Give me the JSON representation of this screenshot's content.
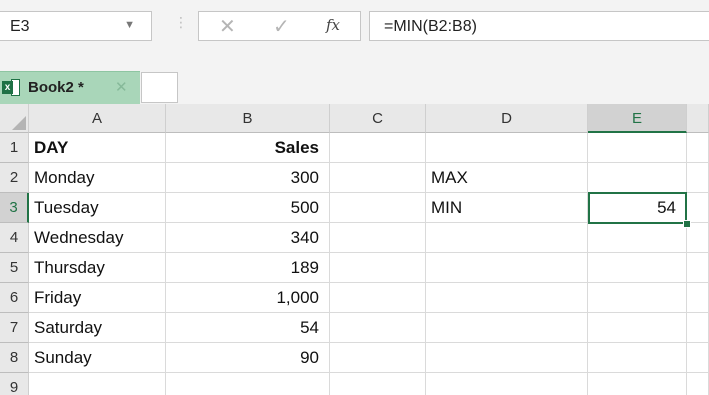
{
  "formula_bar": {
    "name_box": "E3",
    "name_box_dropdown_icon": "chevron-down-icon",
    "grip_glyph": "⋮",
    "cancel_glyph": "✕",
    "enter_glyph": "✓",
    "fx_label": "fx",
    "formula": "=MIN(B2:B8)"
  },
  "workbook_tab": {
    "label": "Book2 *",
    "close_glyph": "✕",
    "icon": "excel-icon"
  },
  "grid": {
    "columns": [
      "A",
      "B",
      "C",
      "D",
      "E"
    ],
    "rows": [
      "1",
      "2",
      "3",
      "4",
      "5",
      "6",
      "7",
      "8",
      "9"
    ],
    "selected_column": "E",
    "selected_row": "3",
    "cells": {
      "A1": "DAY",
      "B1": "Sales",
      "A2": "Monday",
      "B2": "300",
      "D2": "MAX",
      "A3": "Tuesday",
      "B3": "500",
      "D3": "MIN",
      "E3": "54",
      "A4": "Wednesday",
      "B4": "340",
      "A5": "Thursday",
      "B5": "189",
      "A6": "Friday",
      "B6": "1,000",
      "A7": "Saturday",
      "B7": "54",
      "A8": "Sunday",
      "B8": "90"
    }
  },
  "colors": {
    "accent": "#217346",
    "tab_background": "#a9d6b9"
  }
}
